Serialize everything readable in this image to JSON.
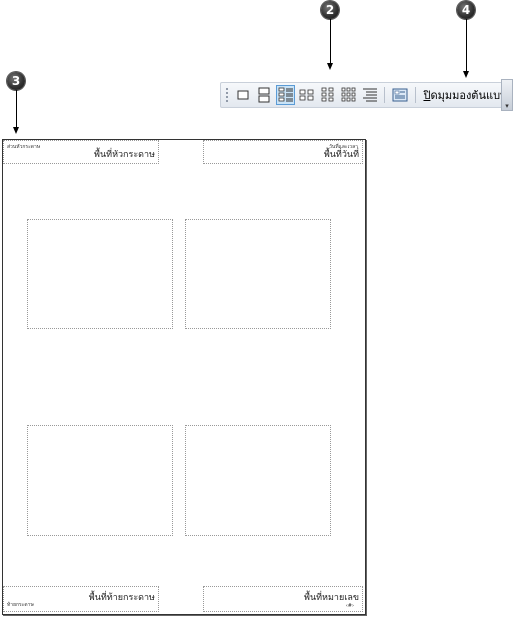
{
  "callouts": {
    "c2": "2",
    "c3": "3",
    "c4": "4"
  },
  "toolbar": {
    "close_label_first": "ปิ",
    "close_label_rest": "ดมุมมองต้นแบบ",
    "dropdown_glyph": "▾"
  },
  "page": {
    "header_small": "ส่วนหัวกระดาษ",
    "header_label": "พื้นที่หัวกระดาษ",
    "date_small": "วันที่และเวลา",
    "date_label": "พื้นที่วันที่",
    "footer_small": "ท้ายกระดาษ",
    "footer_label": "พื้นที่ท้ายกระดาษ",
    "number_label": "พื้นที่หมายเลข",
    "number_small": "‹#›"
  }
}
